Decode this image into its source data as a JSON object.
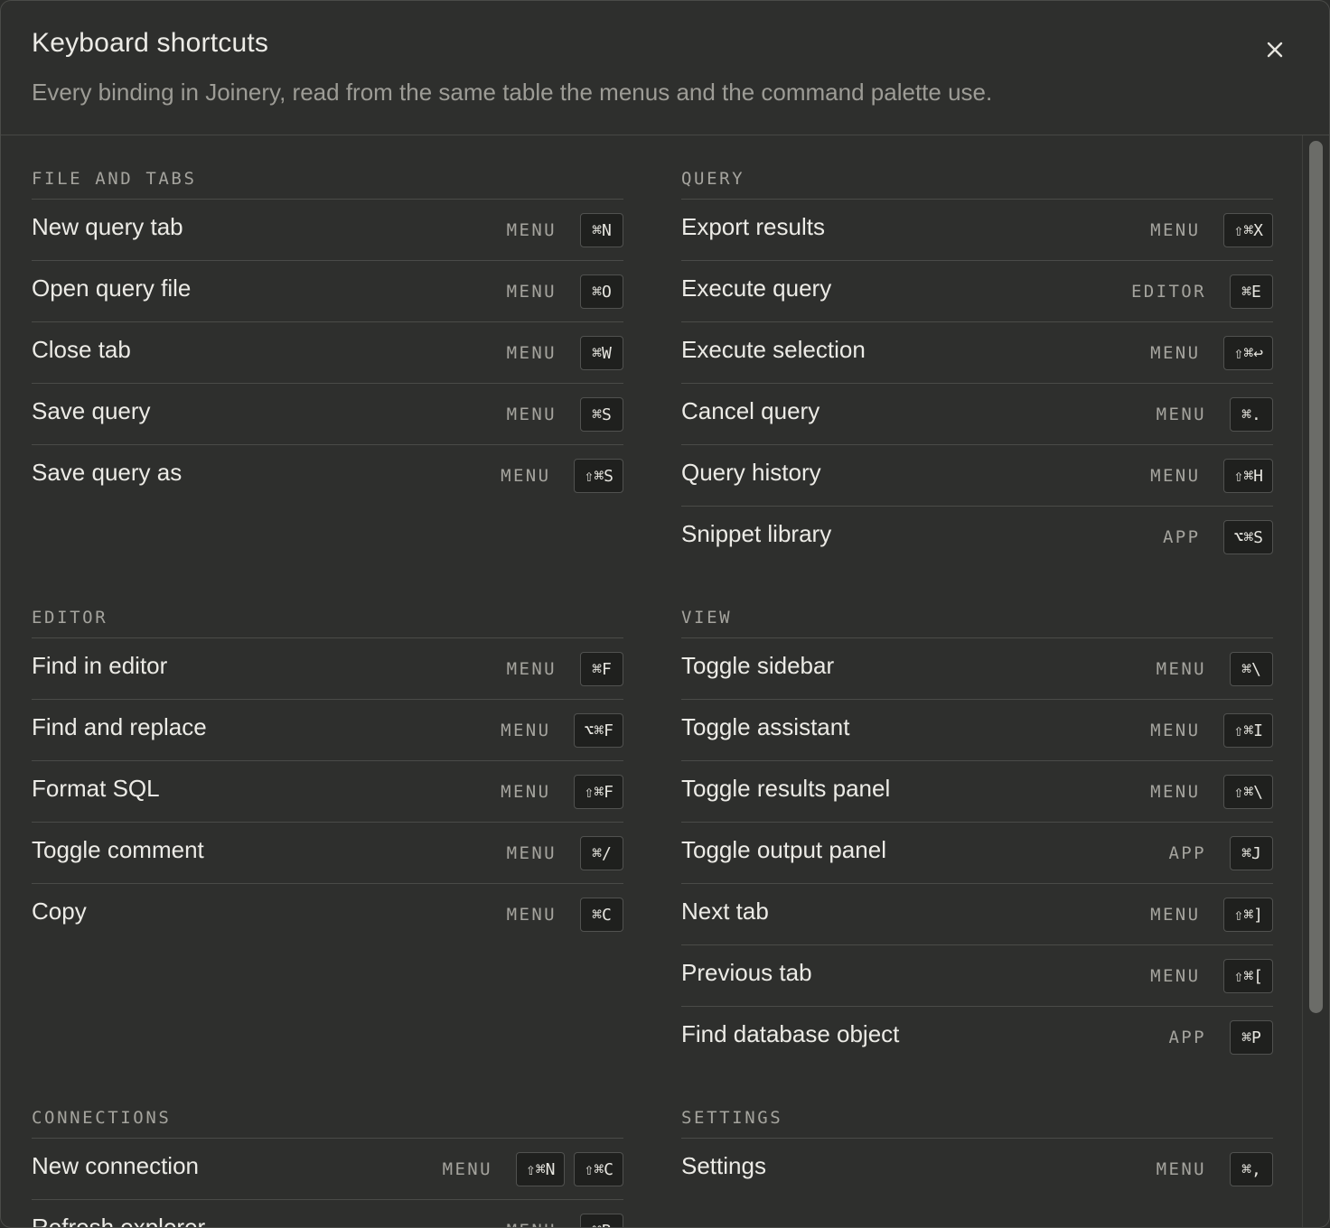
{
  "dialog": {
    "title": "Keyboard shortcuts",
    "subtitle": "Every binding in Joinery, read from the same table the menus and the command palette use.",
    "close_icon": "close-icon"
  },
  "sections": {
    "file_tabs": {
      "title": "FILE AND TABS",
      "rows": [
        {
          "label": "New query tab",
          "scope": "MENU",
          "keys": [
            "⌘N"
          ]
        },
        {
          "label": "Open query file",
          "scope": "MENU",
          "keys": [
            "⌘O"
          ]
        },
        {
          "label": "Close tab",
          "scope": "MENU",
          "keys": [
            "⌘W"
          ]
        },
        {
          "label": "Save query",
          "scope": "MENU",
          "keys": [
            "⌘S"
          ]
        },
        {
          "label": "Save query as",
          "scope": "MENU",
          "keys": [
            "⇧⌘S"
          ]
        }
      ]
    },
    "query": {
      "title": "QUERY",
      "rows": [
        {
          "label": "Export results",
          "scope": "MENU",
          "keys": [
            "⇧⌘X"
          ]
        },
        {
          "label": "Execute query",
          "scope": "EDITOR",
          "keys": [
            "⌘E"
          ]
        },
        {
          "label": "Execute selection",
          "scope": "MENU",
          "keys": [
            "⇧⌘↩"
          ]
        },
        {
          "label": "Cancel query",
          "scope": "MENU",
          "keys": [
            "⌘."
          ]
        },
        {
          "label": "Query history",
          "scope": "MENU",
          "keys": [
            "⇧⌘H"
          ]
        },
        {
          "label": "Snippet library",
          "scope": "APP",
          "keys": [
            "⌥⌘S"
          ]
        }
      ]
    },
    "editor": {
      "title": "EDITOR",
      "rows": [
        {
          "label": "Find in editor",
          "scope": "MENU",
          "keys": [
            "⌘F"
          ]
        },
        {
          "label": "Find and replace",
          "scope": "MENU",
          "keys": [
            "⌥⌘F"
          ]
        },
        {
          "label": "Format SQL",
          "scope": "MENU",
          "keys": [
            "⇧⌘F"
          ]
        },
        {
          "label": "Toggle comment",
          "scope": "MENU",
          "keys": [
            "⌘/"
          ]
        },
        {
          "label": "Copy",
          "scope": "MENU",
          "keys": [
            "⌘C"
          ]
        }
      ]
    },
    "view": {
      "title": "VIEW",
      "rows": [
        {
          "label": "Toggle sidebar",
          "scope": "MENU",
          "keys": [
            "⌘\\"
          ]
        },
        {
          "label": "Toggle assistant",
          "scope": "MENU",
          "keys": [
            "⇧⌘I"
          ]
        },
        {
          "label": "Toggle results panel",
          "scope": "MENU",
          "keys": [
            "⇧⌘\\"
          ]
        },
        {
          "label": "Toggle output panel",
          "scope": "APP",
          "keys": [
            "⌘J"
          ]
        },
        {
          "label": "Next tab",
          "scope": "MENU",
          "keys": [
            "⇧⌘]"
          ]
        },
        {
          "label": "Previous tab",
          "scope": "MENU",
          "keys": [
            "⇧⌘["
          ]
        },
        {
          "label": "Find database object",
          "scope": "APP",
          "keys": [
            "⌘P"
          ]
        }
      ]
    },
    "connections": {
      "title": "CONNECTIONS",
      "rows": [
        {
          "label": "New connection",
          "scope": "MENU",
          "keys": [
            "⇧⌘N",
            "⇧⌘C"
          ]
        },
        {
          "label": "Refresh explorer",
          "scope": "MENU",
          "keys": [
            "⌘R"
          ]
        }
      ]
    },
    "settings": {
      "title": "SETTINGS",
      "rows": [
        {
          "label": "Settings",
          "scope": "MENU",
          "keys": [
            "⌘,"
          ]
        }
      ]
    }
  }
}
